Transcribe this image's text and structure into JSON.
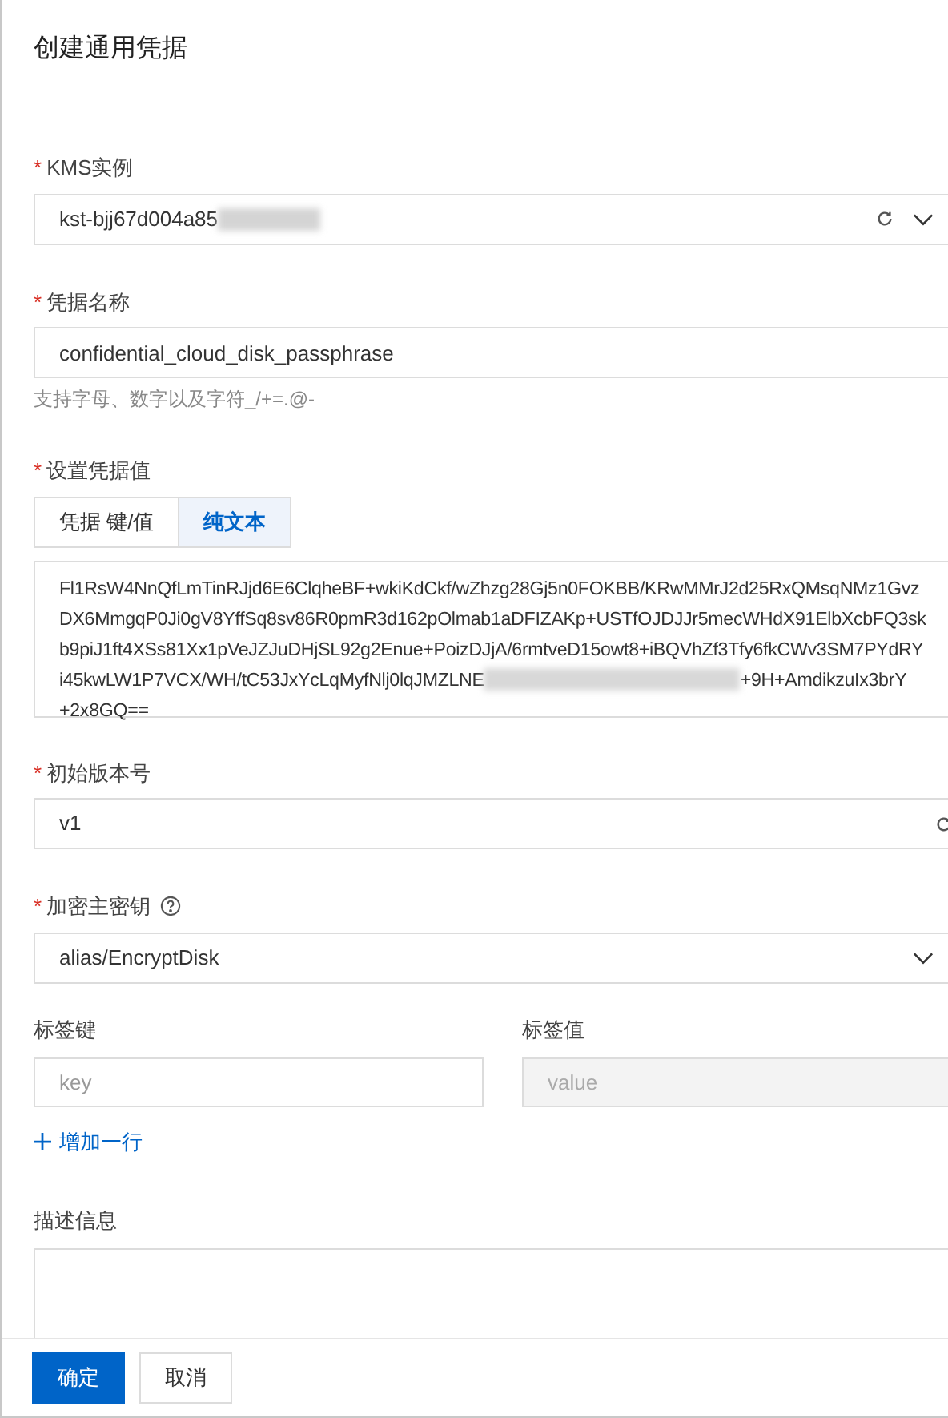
{
  "dialog": {
    "title": "创建通用凭据"
  },
  "kms": {
    "label": "KMS实例",
    "required_mark": "*",
    "value": "kst-bjj67d004a85",
    "redacted": true
  },
  "name": {
    "label": "凭据名称",
    "required_mark": "*",
    "value": "confidential_cloud_disk_passphrase",
    "hint": "支持字母、数字以及字符_/+=.@-"
  },
  "secret": {
    "label": "设置凭据值",
    "required_mark": "*",
    "tabs": [
      {
        "label": "凭据 键/值",
        "selected": false
      },
      {
        "label": "纯文本",
        "selected": true
      }
    ],
    "lines": [
      [
        "Fl1RsW4NnQfLmTinRJjd6E6ClqheBF+wkiKdCkf/wZhzg28Gj5n0FOKBB/KRwMMrJ2d25RxQMsqNMz1Gvz"
      ],
      [
        "DX6MmgqP0Ji0gV8YffSq8sv86R0pmR3d162pOlmab1aDFIZAKp+USTfOJDJJr5mecWHdX91ElbXcbFQ3sk"
      ],
      [
        "b9piJ1ft4XSs81Xx1pVeJZJuDHjSL92g2Enue+PoizDJjA/6rmtveD15owt8+iBQVhZf3Tfy6fkCWv3SM7PYdRY"
      ],
      [
        "i45kwLW1P7VCX/WH/tC53JxYcLqMyfNlj0lqJMZLNE",
        "+9H+AmdikzuIx3brY"
      ],
      [
        "+2x8GQ=="
      ]
    ]
  },
  "version": {
    "label": "初始版本号",
    "required_mark": "*",
    "value": "v1"
  },
  "master_key": {
    "label": "加密主密钥",
    "required_mark": "*",
    "help": true,
    "value": "alias/EncryptDisk"
  },
  "tags": {
    "key_label": "标签键",
    "value_label": "标签值",
    "key_placeholder": "key",
    "value_placeholder": "value",
    "value_disabled": true,
    "add_row": "增加一行"
  },
  "description": {
    "label": "描述信息"
  },
  "buttons": [
    {
      "label": "确定",
      "primary": true
    },
    {
      "label": "取消",
      "primary": false
    }
  ]
}
